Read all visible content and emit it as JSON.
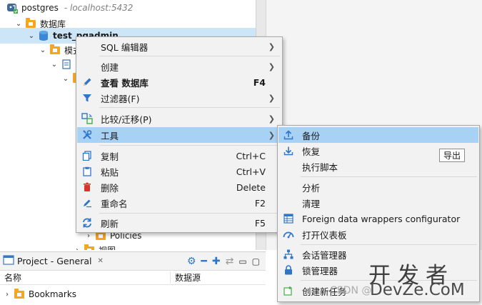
{
  "tree": {
    "connection": {
      "name": "postgres",
      "host": "- localhost:5432"
    },
    "databases_label": "数据库",
    "selected_db": "test_pgadmin",
    "schemas_label": "模式",
    "policies_label": "Policies",
    "views_label": "视图"
  },
  "context_menu": {
    "items": [
      {
        "label": "SQL 编辑器",
        "shortcut": "",
        "submenu": true,
        "icon": ""
      },
      {
        "label": "创建",
        "shortcut": "",
        "submenu": true,
        "icon": ""
      },
      {
        "label": "查看 数据库",
        "shortcut": "F4",
        "submenu": false,
        "icon": "pencil-icon"
      },
      {
        "label": "过滤器(F)",
        "shortcut": "",
        "submenu": true,
        "icon": "filter-icon"
      },
      {
        "label": "比较/迁移(P)",
        "shortcut": "",
        "submenu": true,
        "icon": "compare-icon"
      },
      {
        "label": "工具",
        "shortcut": "",
        "submenu": true,
        "icon": "tools-icon"
      },
      {
        "label": "复制",
        "shortcut": "Ctrl+C",
        "submenu": false,
        "icon": "copy-icon"
      },
      {
        "label": "粘贴",
        "shortcut": "Ctrl+V",
        "submenu": false,
        "icon": "paste-icon"
      },
      {
        "label": "删除",
        "shortcut": "Delete",
        "submenu": false,
        "icon": "delete-icon"
      },
      {
        "label": "重命名",
        "shortcut": "F2",
        "submenu": false,
        "icon": "rename-icon"
      },
      {
        "label": "刷新",
        "shortcut": "F5",
        "submenu": false,
        "icon": "refresh-icon"
      }
    ]
  },
  "tools_submenu": {
    "items": [
      {
        "label": "备份",
        "icon": "upload-icon"
      },
      {
        "label": "恢复",
        "icon": "download-icon"
      },
      {
        "label": "执行脚本",
        "icon": ""
      },
      {
        "label": "分析",
        "icon": ""
      },
      {
        "label": "清理",
        "icon": ""
      },
      {
        "label": "Foreign data wrappers configurator",
        "icon": "table-icon"
      },
      {
        "label": "打开仪表板",
        "icon": "dashboard-icon"
      },
      {
        "label": "会话管理器",
        "icon": "network-icon"
      },
      {
        "label": "锁管理器",
        "icon": "lock-icon"
      },
      {
        "label": "创建新任务",
        "icon": "task-icon"
      }
    ]
  },
  "tooltip": "导出",
  "project": {
    "title": "Project - General",
    "col_name": "名称",
    "col_source": "数据源",
    "bookmarks": "Bookmarks"
  },
  "watermark": {
    "big": "开发者",
    "small": "DevZe.CoM",
    "csdn": "CSDN @"
  },
  "colors": {
    "menu_highlight": "#a7d1f5",
    "tree_selection": "#cde6f7",
    "folder": "#f4a522",
    "accent_blue": "#2f76c9",
    "delete_red": "#d9342b"
  }
}
